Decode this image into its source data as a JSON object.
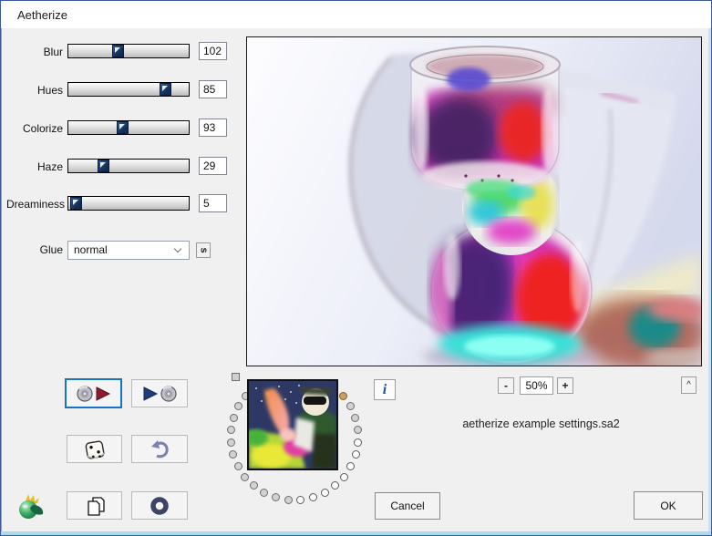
{
  "window": {
    "title": "Aetherize"
  },
  "params": [
    {
      "id": "blur",
      "label": "Blur",
      "value": "102",
      "pos": 41
    },
    {
      "id": "hues",
      "label": "Hues",
      "value": "85",
      "pos": 80
    },
    {
      "id": "colorize",
      "label": "Colorize",
      "value": "93",
      "pos": 45
    },
    {
      "id": "haze",
      "label": "Haze",
      "value": "29",
      "pos": 29
    },
    {
      "id": "dreaminess",
      "label": "Dreaminess",
      "value": "5",
      "pos": 6
    }
  ],
  "glue": {
    "label": "Glue",
    "selected": "normal",
    "side_button_label": "s"
  },
  "zoom_controls": {
    "minus": "-",
    "level": "50%",
    "plus": "+",
    "collapse": "^"
  },
  "info_button_label": "i",
  "settings_file": "aetherize example settings.sa2",
  "action_buttons": {
    "cancel": "Cancel",
    "ok": "OK"
  },
  "dial": {
    "dot_count": 24,
    "start_angle_deg": -40,
    "arc_deg": 260,
    "orange_index": 0,
    "white_indexes": [
      4,
      5,
      6,
      7,
      8,
      9,
      10,
      11
    ]
  },
  "colors": {
    "focus_border": "#1673c6",
    "handle_navy": "#16355e",
    "dialog_border_blue": "#3a5a9c",
    "selected_dot_orange": "#c9a263"
  }
}
